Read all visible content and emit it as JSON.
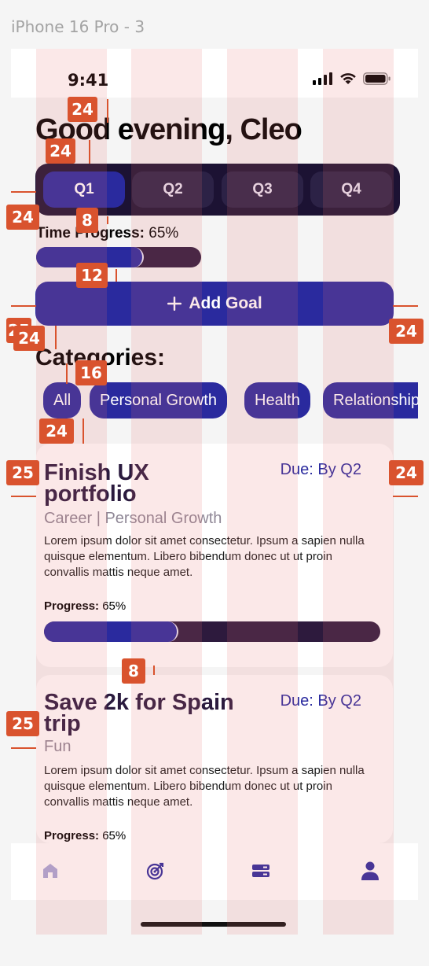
{
  "frame": {
    "title": "iPhone 16 Pro - 3"
  },
  "status_bar": {
    "time": "9:41"
  },
  "greeting": "Good evening, Cleo",
  "quarters": [
    {
      "label": "Q1",
      "active": true
    },
    {
      "label": "Q2",
      "active": false
    },
    {
      "label": "Q3",
      "active": false
    },
    {
      "label": "Q4",
      "active": false
    }
  ],
  "time_progress": {
    "label": "Time Progress:",
    "value_text": "65%",
    "value": 0.65
  },
  "add_goal": {
    "icon": "plus-icon",
    "label": "Add Goal"
  },
  "categories": {
    "title": "Categories:",
    "chips": [
      "All",
      "Personal Growth",
      "Health",
      "Relationships"
    ]
  },
  "goals": [
    {
      "title_line1": "Finish UX",
      "title_line2": "portfolio",
      "due": "Due: By Q2",
      "categories": "Career | Personal Growth",
      "description": "Lorem ipsum dolor sit amet consectetur. Ipsum a sapien nulla quisque elementum. Libero bibendum donec ut ut proin convallis mattis neque amet.",
      "progress_label": "Progress:",
      "progress_text": "65%",
      "progress": 0.4
    },
    {
      "title_line1": "Save 2k for Spain",
      "title_line2": "trip",
      "due": "Due: By Q2",
      "categories": "Fun",
      "description": "Lorem ipsum dolor sit amet consectetur. Ipsum a sapien nulla quisque elementum. Libero bibendum donec ut ut proin convallis mattis neque amet.",
      "progress_label": "Progress:",
      "progress_text": "65%"
    }
  ],
  "nav": [
    {
      "icon": "home-icon",
      "active": true
    },
    {
      "icon": "target-icon",
      "active": false
    },
    {
      "icon": "storage-icon",
      "active": false
    },
    {
      "icon": "profile-icon",
      "active": false
    }
  ],
  "spacing_annotations": [
    "24",
    "24",
    "24",
    "8",
    "12",
    "25",
    "24",
    "24",
    "16",
    "24",
    "25",
    "24",
    "8",
    "25"
  ],
  "colors": {
    "primary": "#2a2a9e",
    "dark": "#1c1233",
    "track": "#2d1a3d",
    "annotation": "#d9532e"
  }
}
